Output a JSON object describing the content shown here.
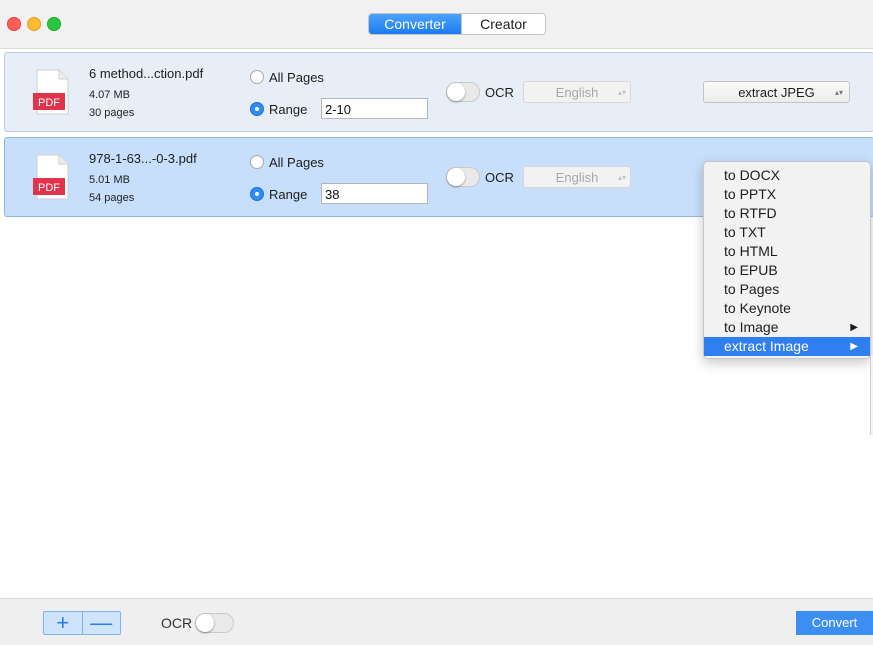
{
  "tabs": {
    "converter": "Converter",
    "creator": "Creator"
  },
  "files": [
    {
      "name": "6 method...ction.pdf",
      "size": "4.07 MB",
      "pages": "30 pages",
      "icon_label": "PDF",
      "all_pages_label": "All Pages",
      "range_label": "Range",
      "range_value": "2-10",
      "ocr_label": "OCR",
      "language": "English",
      "format": "extract JPEG"
    },
    {
      "name": "978-1-63...-0-3.pdf",
      "size": "5.01 MB",
      "pages": "54 pages",
      "icon_label": "PDF",
      "all_pages_label": "All Pages",
      "range_label": "Range",
      "range_value": "38",
      "ocr_label": "OCR",
      "language": "English"
    }
  ],
  "menu": {
    "items": [
      "to DOCX",
      "to PPTX",
      "to RTFD",
      "to TXT",
      "to HTML",
      "to EPUB",
      "to Pages",
      "to Keynote",
      "to Image",
      "extract Image"
    ],
    "highlighted": "extract Image"
  },
  "bottom": {
    "add": "+",
    "remove": "—",
    "ocr_label": "OCR",
    "convert": "Convert"
  },
  "colors": {
    "accent": "#2f7ff0",
    "selected_row": "#c7dffa",
    "pdf_red": "#e0334c"
  }
}
